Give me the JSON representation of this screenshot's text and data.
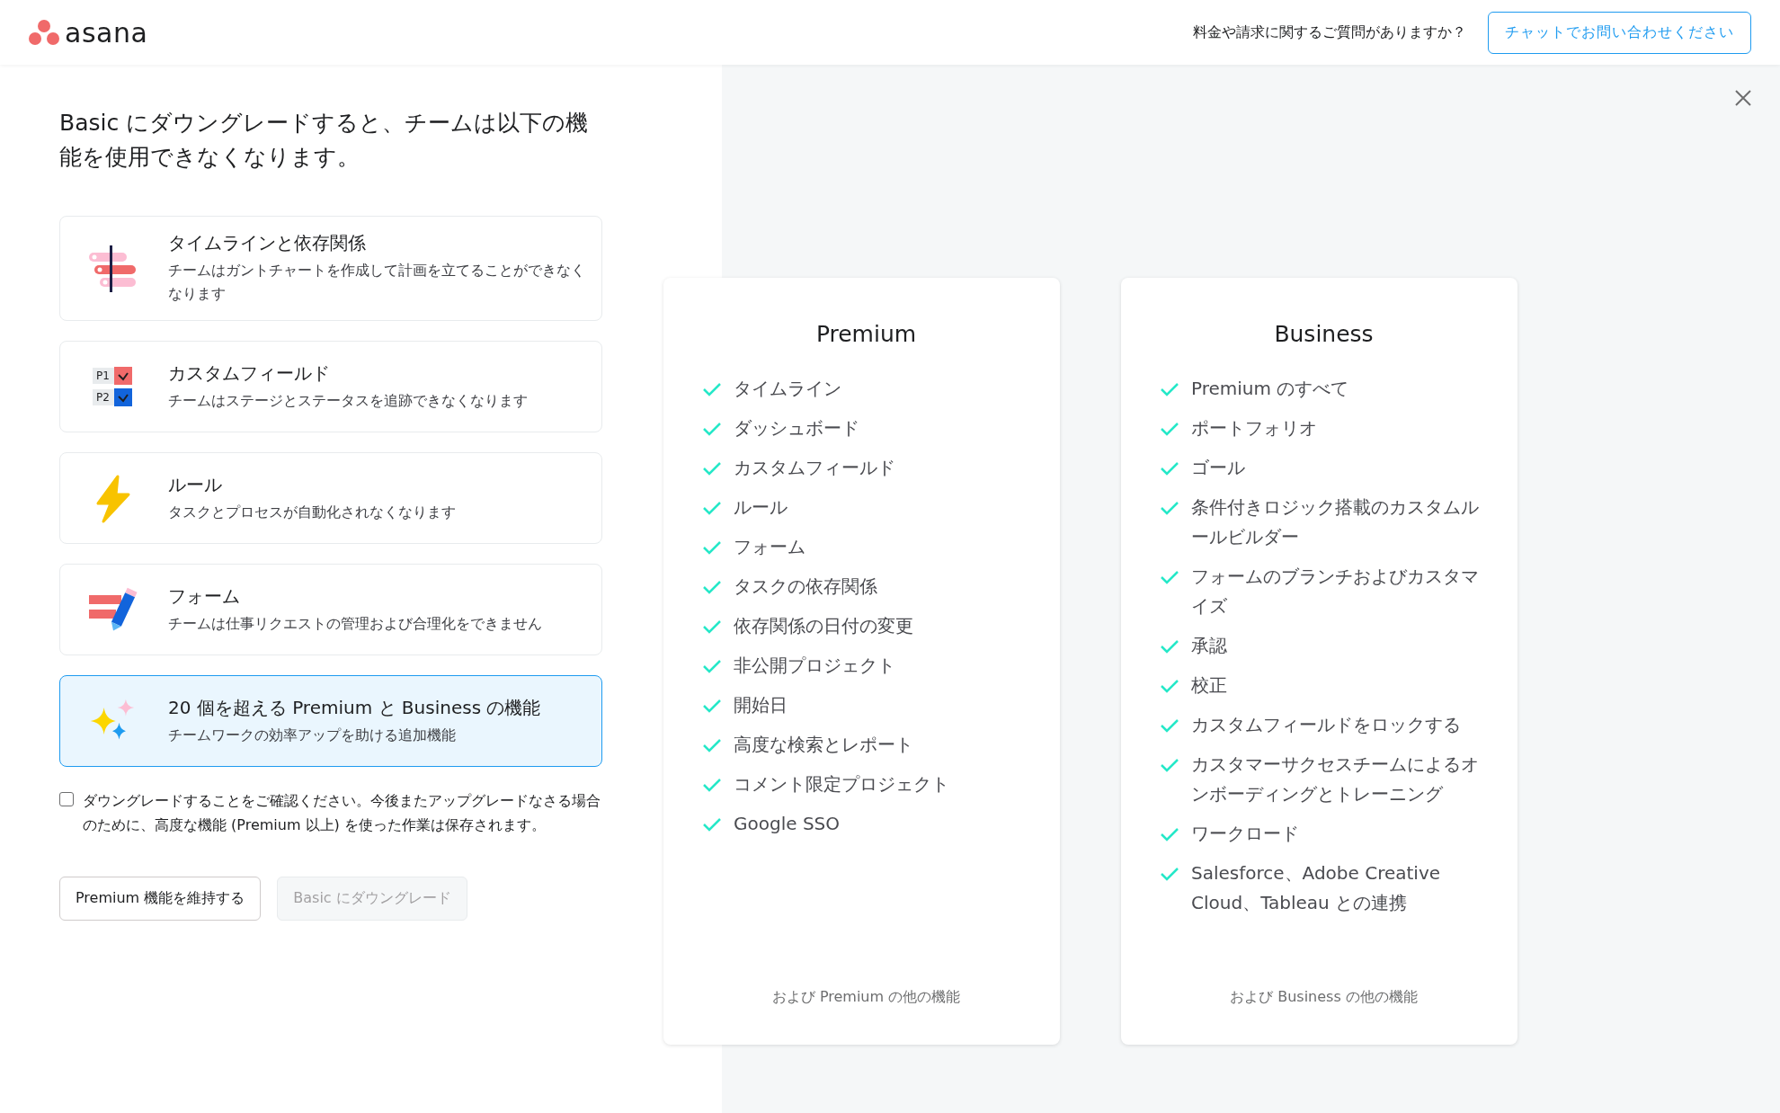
{
  "header": {
    "logo": "asana",
    "question": "料金や請求に関するご質問がありますか？",
    "chat_button": "チャットでお問い合わせください"
  },
  "heading": "Basic にダウングレードすると、チームは以下の機能を使用できなくなります。",
  "features": [
    {
      "kind": "timeline",
      "title": "タイムラインと依存関係",
      "description": "チームはガントチャートを作成して計画を立てることができなくなります",
      "selected": false
    },
    {
      "kind": "fields",
      "title": "カスタムフィールド",
      "description": "チームはステージとステータスを追跡できなくなります",
      "selected": false,
      "icon_labels": [
        "P1",
        "P2"
      ]
    },
    {
      "kind": "rules",
      "title": "ルール",
      "description": "タスクとプロセスが自動化されなくなります",
      "selected": false
    },
    {
      "kind": "forms",
      "title": "フォーム",
      "description": "チームは仕事リクエストの管理および合理化をできません",
      "selected": false
    },
    {
      "kind": "sparkles",
      "title": "20 個を超える Premium と Business の機能",
      "description": "チームワークの効率アップを助ける追加機能",
      "selected": true
    }
  ],
  "confirm": {
    "label": "ダウングレードすることをご確認ください。今後またアップグレードなさる場合のために、高度な機能 (Premium 以上) を使った作業は保存されます。",
    "checked": false
  },
  "buttons": [
    {
      "label": "Premium 機能を維持する",
      "disabled": false
    },
    {
      "label": "Basic にダウングレード",
      "disabled": true
    }
  ],
  "plans": [
    {
      "name": "Premium",
      "items": [
        "タイムライン",
        "ダッシュボード",
        "カスタムフィールド",
        "ルール",
        "フォーム",
        "タスクの依存関係",
        "依存関係の日付の変更",
        "非公開プロジェクト",
        "開始日",
        "高度な検索とレポート",
        "コメント限定プロジェクト",
        "Google SSO"
      ],
      "footer": "および Premium の他の機能"
    },
    {
      "name": "Business",
      "items": [
        "Premium のすべて",
        "ポートフォリオ",
        "ゴール",
        "条件付きロジック搭載のカスタムルールビルダー",
        "フォームのブランチおよびカスタマイズ",
        "承認",
        "校正",
        "カスタムフィールドをロックする",
        "カスタマーサクセスチームによるオンボーディングとトレーニング",
        "ワークロード",
        "Salesforce、Adobe Creative Cloud、Tableau との連携"
      ],
      "footer": "および Business の他の機能"
    }
  ]
}
